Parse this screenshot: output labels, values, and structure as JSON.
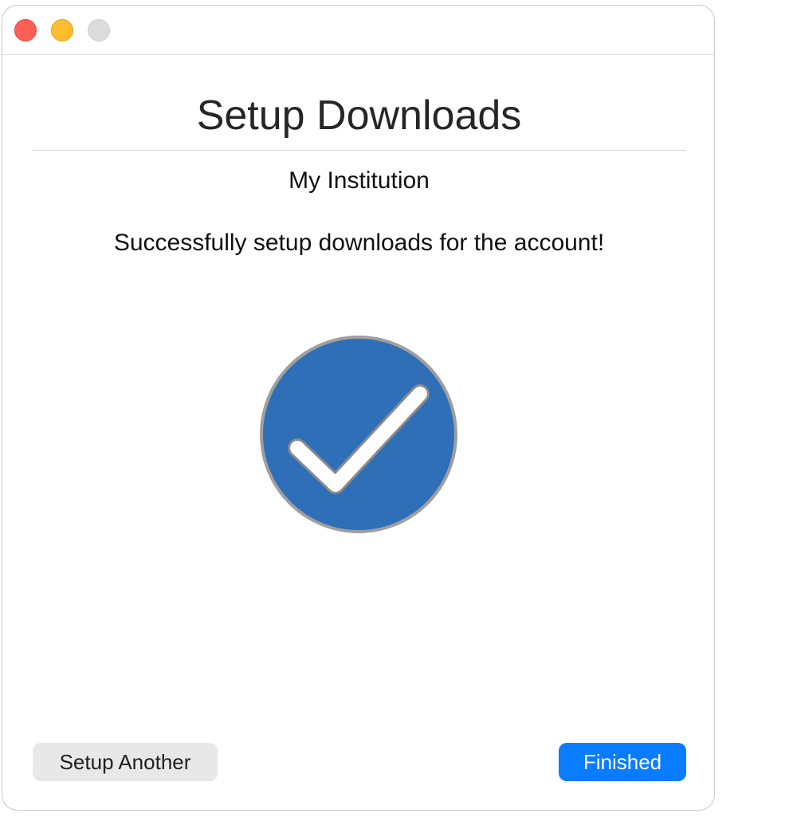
{
  "window": {
    "title": "Setup Downloads",
    "institution": "My Institution",
    "message": "Successfully setup downloads for the account!"
  },
  "icons": {
    "status": "checkmark-circle-icon"
  },
  "colors": {
    "accent": "#0a7cff",
    "check_circle": "#2e6fb7",
    "close": "#fe5f57",
    "minimize": "#febc2e",
    "zoom_disabled": "#dcdcdc"
  },
  "buttons": {
    "secondary_label": "Setup Another",
    "primary_label": "Finished"
  }
}
